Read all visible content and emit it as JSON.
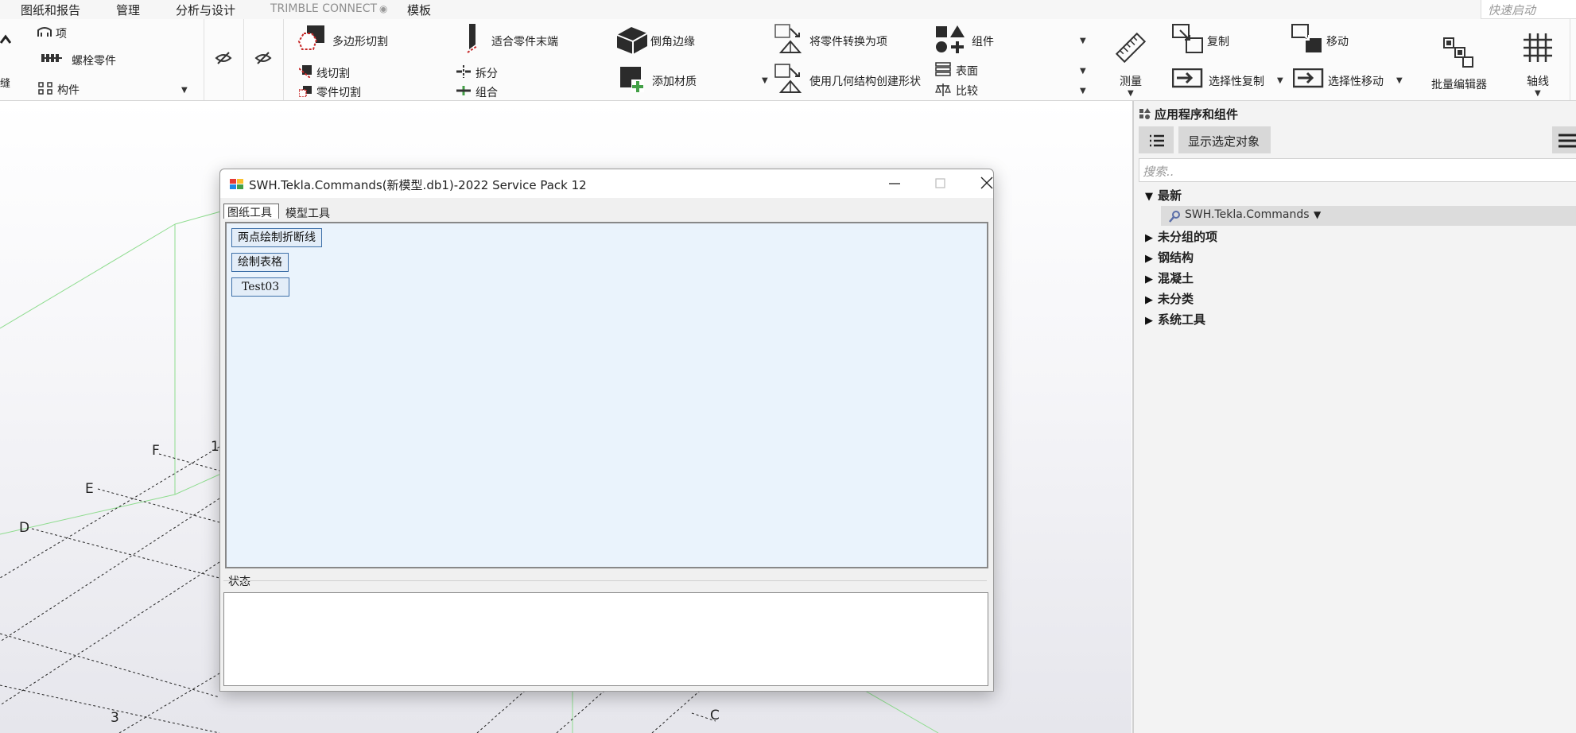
{
  "menubar": {
    "items": [
      "图纸和报告",
      "管理",
      "分析与设计",
      "TRIMBLE CONNECT",
      "模板"
    ],
    "quick_launch_placeholder": "快速启动"
  },
  "ribbon": {
    "item": "项",
    "bolt_part": "螺栓零件",
    "component_tool": "构件",
    "polygon_cut": "多边形切割",
    "line_cut": "线切割",
    "part_cut": "零件切割",
    "fit_part_end": "适合零件末端",
    "split": "拆分",
    "combine": "组合",
    "chamfer_edges": "倒角边缘",
    "add_material": "添加材质",
    "convert_to_item": "将零件转换为项",
    "create_shape": "使用几何结构创建形状",
    "components": "组件",
    "surface": "表面",
    "compare": "比较",
    "measure": "测量",
    "copy": "复制",
    "copy_selective": "选择性复制",
    "move": "移动",
    "move_selective": "选择性移动",
    "bulk_editor": "批量编辑器",
    "grid": "轴线"
  },
  "dialog": {
    "title": "SWH.Tekla.Commands(新模型.db1)-2022 Service Pack 12",
    "tabs": [
      "图纸工具",
      "模型工具"
    ],
    "buttons": [
      "两点绘制折断线",
      "绘制表格",
      "Test03"
    ],
    "status_label": "状态",
    "status_text": ""
  },
  "side_panel": {
    "title": "应用程序和组件",
    "show_selected": "显示选定对象",
    "search_placeholder": "搜索..",
    "tree": {
      "recent": "最新",
      "recent_child": "SWH.Tekla.Commands",
      "groups": [
        "未分组的项",
        "钢结构",
        "混凝土",
        "未分类",
        "系统工具"
      ]
    }
  },
  "viewport": {
    "grid_labels": [
      "F",
      "E",
      "D",
      "1",
      "3",
      "C"
    ]
  },
  "colors": {
    "accent_blue": "#3d6fa8",
    "panel_bg": "#eaf3fc",
    "icon_dark": "#2b2b2b",
    "icon_red": "#c62828",
    "icon_green": "#43a047"
  }
}
